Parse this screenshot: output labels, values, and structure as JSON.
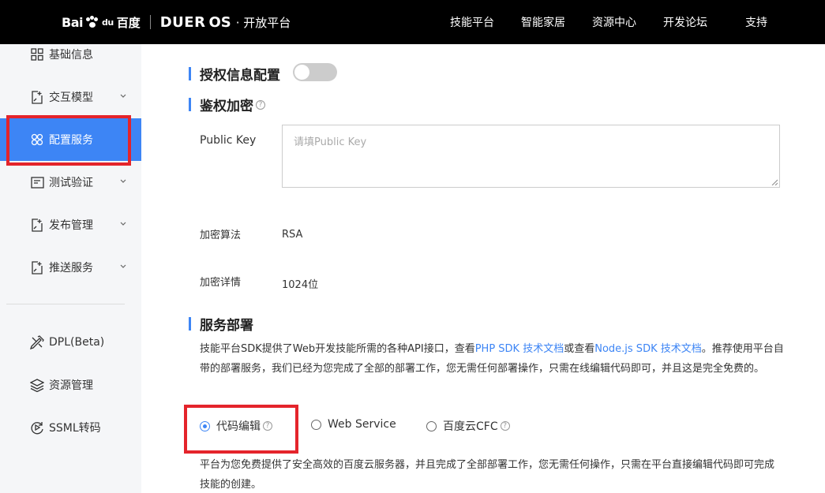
{
  "header": {
    "logo_bai": "Bai",
    "logo_du": "du",
    "logo_baidu_cn": "百度",
    "logo_duer": "DUER",
    "logo_os": "OS",
    "logo_platform": "· 开放平台",
    "nav": [
      "技能平台",
      "智能家居",
      "资源中心",
      "开发论坛",
      "支持"
    ]
  },
  "sidebar": {
    "items": [
      {
        "label": "基础信息",
        "icon": "grid-icon"
      },
      {
        "label": "交互模型",
        "icon": "doc-plus-icon"
      },
      {
        "label": "配置服务",
        "icon": "flower-icon"
      },
      {
        "label": "测试验证",
        "icon": "terminal-icon"
      },
      {
        "label": "发布管理",
        "icon": "doc-plus-icon"
      },
      {
        "label": "推送服务",
        "icon": "doc-plus-icon"
      }
    ],
    "tools": [
      {
        "label": "DPL(Beta)",
        "icon": "tools-icon"
      },
      {
        "label": "资源管理",
        "icon": "layers-icon"
      },
      {
        "label": "SSML转码",
        "icon": "sync-play-icon"
      }
    ]
  },
  "main": {
    "auth_title": "授权信息配置",
    "encrypt_title": "鉴权加密",
    "public_key_label": "Public Key",
    "public_key_placeholder": "请填Public Key",
    "algo_label": "加密算法",
    "algo_value": "RSA",
    "detail_label": "加密详情",
    "detail_value": "1024位",
    "deploy_title": "服务部署",
    "deploy_text_1": "技能平台SDK提供了Web开发技能所需的各种API接口，查看",
    "deploy_link_php": "PHP SDK 技术文档",
    "deploy_text_2": "或查看",
    "deploy_link_node": "Node.js SDK 技术文档",
    "deploy_text_3": "。推荐使用平台自带的部署服务，我们已经为您完成了全部的部署工作，您无需任何部署操作，只需在线编辑代码即可，并且这是完全免费的。",
    "radio_options": [
      "代码编辑",
      "Web Service",
      "百度云CFC"
    ],
    "selected_option": "代码编辑",
    "footer_text": "平台为您免费提供了安全高效的百度云服务器，并且完成了全部部署工作，您无需任何操作，只需在平台直接编辑代码即可完成技能的创建。"
  },
  "colors": {
    "accent": "#3d85f5",
    "highlight": "#e4242b",
    "topbar": "#000000",
    "sidebar_bg": "#f5f6f8"
  }
}
